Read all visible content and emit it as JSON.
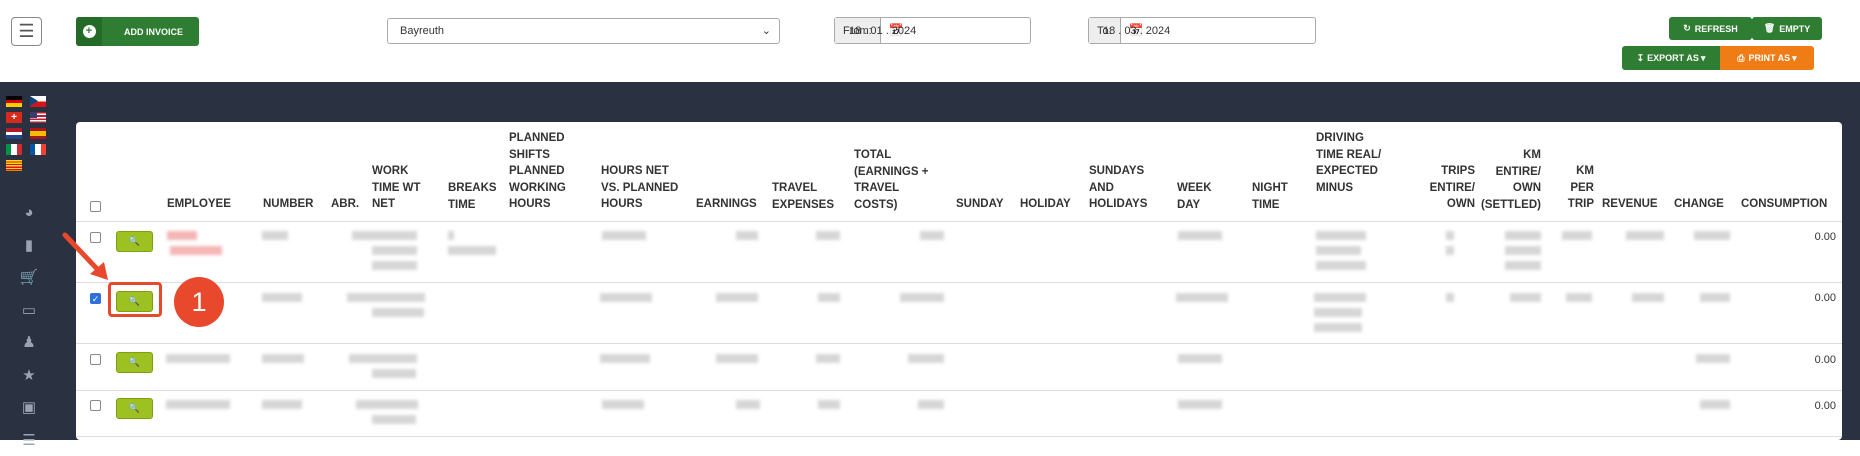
{
  "toolbar": {
    "add_invoice": "ADD INVOICE",
    "location_value": "Bayreuth",
    "from_label": "From:",
    "from_value": "18 . 01 . 2024",
    "to_label": "To:",
    "to_value": "18 . 03 . 2024",
    "refresh": "REFRESH",
    "empty": "EMPTY",
    "export_as": "EXPORT AS",
    "print_as": "PRINT AS"
  },
  "sidebar": {
    "flags": [
      "de",
      "cz",
      "ch",
      "us",
      "nl",
      "es",
      "it",
      "fr",
      "ca"
    ],
    "icons": [
      "gauge-icon",
      "bar-chart-icon",
      "cart-icon",
      "monitor-icon",
      "user-plus-icon",
      "star-icon",
      "archive-icon",
      "list-icon"
    ]
  },
  "table": {
    "headers": {
      "employee": "EMPLOYEE",
      "number": "NUMBER",
      "abr": "ABR.",
      "work_time": "WORK TIME WT NET",
      "breaks_time": "BREAKS TIME",
      "planned": "PLANNED SHIFTS PLANNED WORKING HOURS",
      "hours_net": "HOURS NET VS. PLANNED HOURS",
      "earnings": "EARNINGS",
      "travel": "TRAVEL EXPENSES",
      "total": "TOTAL (EARNINGS + TRAVEL COSTS)",
      "sunday": "SUNDAY",
      "holiday": "HOLIDAY",
      "sundays_holidays": "SUNDAYS AND HOLIDAYS",
      "week_day": "WEEK DAY",
      "night_time": "NIGHT TIME",
      "driving_time": "DRIVING TIME REAL/ EXPECTED MINUS",
      "trips": "TRIPS ENTIRE/ OWN",
      "km_entire": "KM ENTIRE/ OWN (SETTLED)",
      "km_per_trip": "KM PER TRIP",
      "revenue": "REVENUE",
      "change": "CHANGE",
      "consumption": "CONSUMPTION"
    },
    "rows": [
      {
        "checked": false,
        "consumption": "0.00"
      },
      {
        "checked": true,
        "consumption": "0.00"
      },
      {
        "checked": false,
        "consumption": "0.00"
      },
      {
        "checked": false,
        "consumption": "0.00"
      }
    ]
  },
  "annotation": {
    "step_number": "1"
  },
  "colors": {
    "green": "#2e7d32",
    "orange": "#f07c16",
    "lime": "#9dc120",
    "highlight": "#e8482c",
    "sidebar": "#2a3140"
  }
}
